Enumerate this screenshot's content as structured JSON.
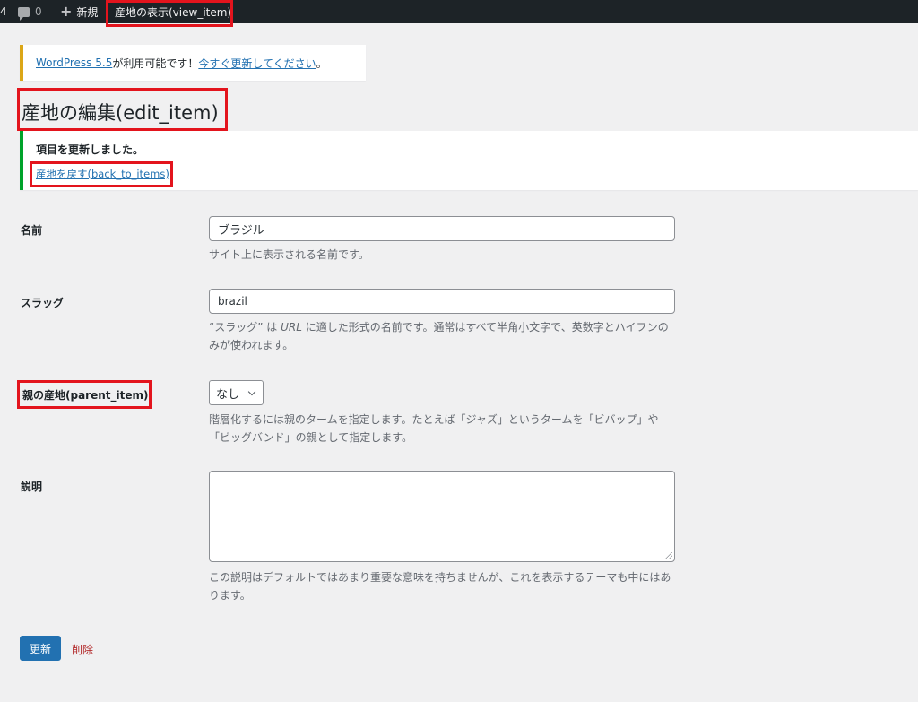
{
  "adminbar": {
    "edge_text": "4",
    "comments_count": "0",
    "new_label": "新規",
    "view_item_label": "産地の表示(view_item)"
  },
  "nag": {
    "link1": "WordPress 5.5",
    "middle": " が利用可能です！",
    "link2": "今すぐ更新してください",
    "end": "。"
  },
  "page_title": "産地の編集(edit_item)",
  "notice": {
    "message": "項目を更新しました。",
    "back_link": "産地を戻す(back_to_items)"
  },
  "form": {
    "name": {
      "label": "名前",
      "value": "ブラジル",
      "description": "サイト上に表示される名前です。"
    },
    "slug": {
      "label": "スラッグ",
      "value": "brazil",
      "description_pre": "“スラッグ” は ",
      "description_em": "URL",
      "description_post": " に適した形式の名前です。通常はすべて半角小文字で、英数字とハイフンのみが使われます。"
    },
    "parent": {
      "label": "親の産地(parent_item)",
      "selected": "なし",
      "description": "階層化するには親のタームを指定します。たとえば「ジャズ」というタームを「ビバップ」や「ビッグバンド」の親として指定します。"
    },
    "description": {
      "label": "説明",
      "value": "",
      "description": "この説明はデフォルトではあまり重要な意味を持ちませんが、これを表示するテーマも中にはあります。"
    }
  },
  "actions": {
    "update_label": "更新",
    "delete_label": "削除"
  },
  "colors": {
    "highlight": "#e3141d",
    "primary": "#2271b1",
    "success": "#00a32a",
    "warning": "#dba617",
    "danger": "#b32d2e"
  }
}
